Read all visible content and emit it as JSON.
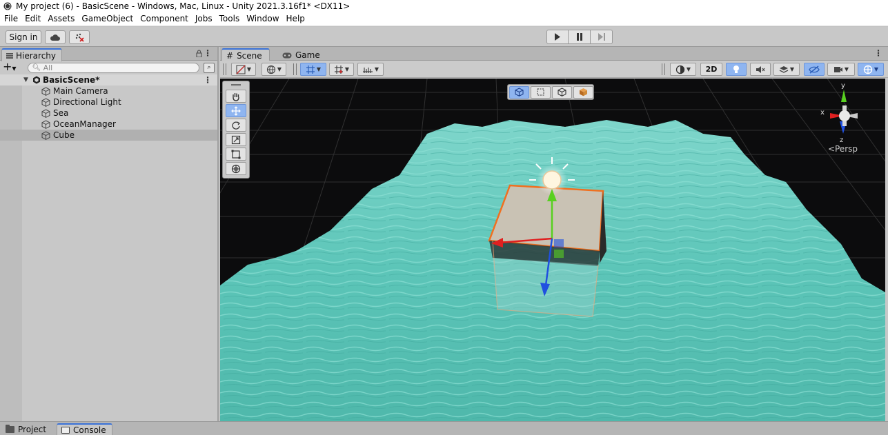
{
  "window": {
    "title": "My project (6) - BasicScene - Windows, Mac, Linux - Unity 2021.3.16f1* <DX11>"
  },
  "menu": [
    "File",
    "Edit",
    "Assets",
    "GameObject",
    "Component",
    "Jobs",
    "Tools",
    "Window",
    "Help"
  ],
  "toolbar": {
    "sign_in_label": "Sign in",
    "cloud_icon": "cloud-icon",
    "collab_icon": "collab-icon"
  },
  "hierarchy": {
    "tab_label": "Hierarchy",
    "search_placeholder": "All",
    "scene_name": "BasicScene*",
    "items": [
      "Main Camera",
      "Directional Light",
      "Sea",
      "OceanManager",
      "Cube"
    ],
    "selected_item": "Cube"
  },
  "scene_view": {
    "tabs": [
      "Scene",
      "Game"
    ],
    "active_tab": "Scene",
    "toggle_2d_label": "2D",
    "camera_mode": "Persp",
    "axis_labels": {
      "x": "x",
      "y": "y",
      "z": "z"
    },
    "colors": {
      "selection_outline": "#f07020",
      "accent": "#3a72d8",
      "water": "#58c4b8",
      "x_axis": "#e02020",
      "y_axis": "#58d020",
      "z_axis": "#2050e0"
    }
  },
  "bottom_tabs": [
    "Project",
    "Console"
  ],
  "bottom_active_tab": "Console"
}
